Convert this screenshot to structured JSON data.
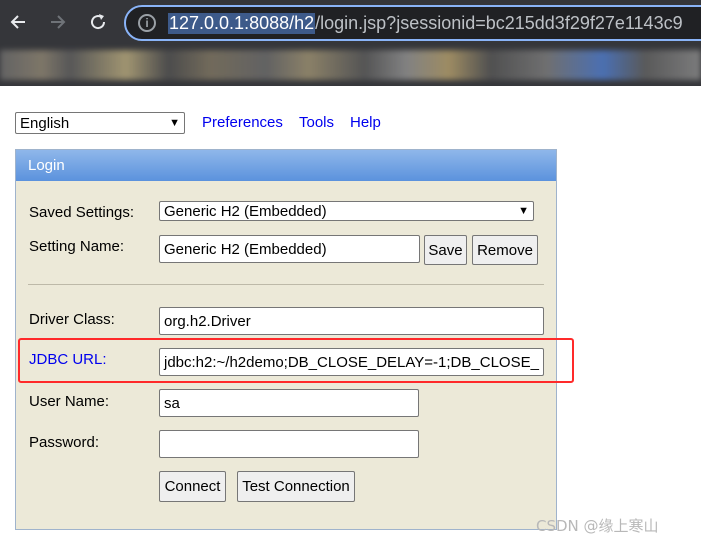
{
  "browser": {
    "url_host": "127.0.0.1:8088/h2",
    "url_rest": "/login.jsp?jsessionid=bc215dd3f29f27e1143c9"
  },
  "toolbar": {
    "language": "English",
    "links": [
      "Preferences",
      "Tools",
      "Help"
    ]
  },
  "login": {
    "header": "Login",
    "saved_settings_label": "Saved Settings:",
    "saved_settings_value": "Generic H2 (Embedded)",
    "setting_name_label": "Setting Name:",
    "setting_name_value": "Generic H2 (Embedded)",
    "save_label": "Save",
    "remove_label": "Remove",
    "driver_class_label": "Driver Class:",
    "driver_class_value": "org.h2.Driver",
    "jdbc_url_label": "JDBC URL:",
    "jdbc_url_value": "jdbc:h2:~/h2demo;DB_CLOSE_DELAY=-1;DB_CLOSE_",
    "user_name_label": "User Name:",
    "user_name_value": "sa",
    "password_label": "Password:",
    "password_value": "",
    "connect_label": "Connect",
    "test_label": "Test Connection"
  },
  "watermark": "CSDN @缘上寒山",
  "colors": {
    "highlight": "#ff2a2a",
    "panel_bg": "#ece9d8",
    "header_blue": "#6b9fe3",
    "link": "#0000ee"
  }
}
